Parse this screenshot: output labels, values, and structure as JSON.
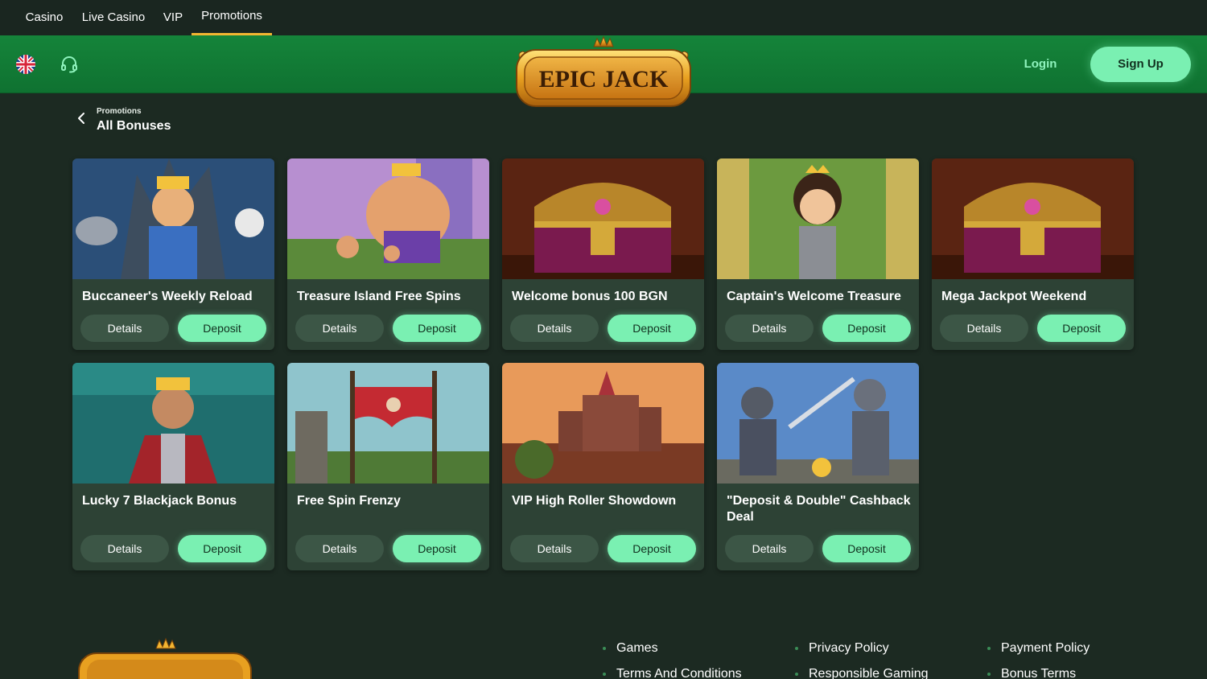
{
  "topnav": {
    "tabs": [
      {
        "label": "Casino",
        "active": false
      },
      {
        "label": "Live Casino",
        "active": false
      },
      {
        "label": "VIP",
        "active": false
      },
      {
        "label": "Promotions",
        "active": true
      }
    ]
  },
  "header": {
    "logo_text": "EPIC JACK",
    "language_icon": "uk-flag-icon",
    "support_icon": "headset-icon",
    "login_label": "Login",
    "signup_label": "Sign Up"
  },
  "breadcrumb": {
    "parent": "Promotions",
    "title": "All Bonuses"
  },
  "buttons": {
    "details": "Details",
    "deposit": "Deposit"
  },
  "bonuses": [
    {
      "title": "Buccaneer's Weekly Reload",
      "art": "king-on-throne"
    },
    {
      "title": "Treasure Island Free Spins",
      "art": "barbarian-king"
    },
    {
      "title": "Welcome bonus 100 BGN",
      "art": "treasure-chest"
    },
    {
      "title": "Captain's Welcome Treasure",
      "art": "princess"
    },
    {
      "title": "Mega Jackpot Weekend",
      "art": "treasure-chest"
    },
    {
      "title": "Lucky 7 Blackjack Bonus",
      "art": "king-portrait"
    },
    {
      "title": "Free Spin Frenzy",
      "art": "red-banner"
    },
    {
      "title": "VIP High Roller Showdown",
      "art": "castle"
    },
    {
      "title": "\"Deposit & Double\" Cashback Deal",
      "art": "knights"
    }
  ],
  "footer": {
    "links": [
      "Games",
      "Privacy Policy",
      "Payment Policy",
      "Terms And Conditions",
      "Responsible Gaming",
      "Bonus Terms"
    ]
  },
  "colors": {
    "page_bg": "#1c2a22",
    "header_green": "#12803a",
    "card_bg": "#2d4235",
    "accent_mint": "#7af0b2",
    "active_tab_underline": "#f2b531"
  }
}
